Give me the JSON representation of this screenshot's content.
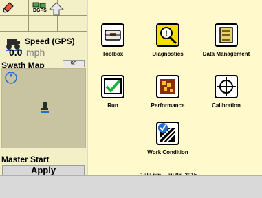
{
  "left": {
    "status": {
      "gps_label": "DGPS"
    },
    "speed": {
      "label": "Speed (GPS)",
      "value": "0.0",
      "unit": "mph"
    },
    "swath": {
      "title": "Swath Map",
      "number": "90"
    },
    "master": {
      "title": "Master Start",
      "apply_label": "Apply"
    }
  },
  "main": {
    "tiles": [
      {
        "label": "Toolbox",
        "icon": "toolbox-icon"
      },
      {
        "label": "Diagnostics",
        "icon": "diagnostics-icon"
      },
      {
        "label": "Data Management",
        "icon": "data-management-icon"
      },
      {
        "label": "Run",
        "icon": "run-check-icon"
      },
      {
        "label": "Performance",
        "icon": "performance-icon"
      },
      {
        "label": "Calibration",
        "icon": "calibration-crosshair-icon"
      },
      {
        "label": "Work Condition",
        "icon": "work-condition-icon"
      }
    ],
    "timestamp": "1:09 pm - Jul 06, 2015"
  },
  "colors": {
    "left_bg": "#f3f0c8",
    "main_bg": "#fff9cc",
    "footer_bg": "#d9d9d9",
    "accent_blue": "#1f6fd1",
    "check_green": "#18b13a",
    "diag_yellow": "#f4e000"
  }
}
